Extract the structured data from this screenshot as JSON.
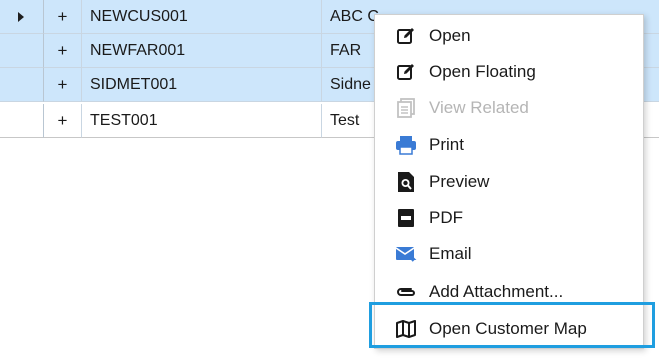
{
  "grid": {
    "rows": [
      {
        "code": "NEWCUS001",
        "name": "ABC C",
        "expand": "+",
        "selected": true,
        "current": true
      },
      {
        "code": "NEWFAR001",
        "name": "FAR",
        "expand": "+",
        "selected": true,
        "current": false
      },
      {
        "code": "SIDMET001",
        "name": "Sidne",
        "expand": "+",
        "selected": true,
        "current": false
      },
      {
        "code": "TEST001",
        "name": "Test",
        "expand": "+",
        "selected": false,
        "current": false
      }
    ]
  },
  "context_menu": {
    "items": [
      {
        "label": "Open",
        "icon": "edit-icon",
        "enabled": true
      },
      {
        "label": "Open Floating",
        "icon": "edit-icon",
        "enabled": true
      },
      {
        "label": "View Related",
        "icon": "related-documents-icon",
        "enabled": false
      },
      {
        "label": "Print",
        "icon": "printer-icon",
        "enabled": true
      },
      {
        "label": "Preview",
        "icon": "preview-icon",
        "enabled": true
      },
      {
        "label": "PDF",
        "icon": "pdf-icon",
        "enabled": true
      },
      {
        "label": "Email",
        "icon": "email-icon",
        "enabled": true
      },
      {
        "label": "Add Attachment...",
        "icon": "paperclip-icon",
        "enabled": true
      },
      {
        "label": "Open Customer Map",
        "icon": "map-icon",
        "enabled": true,
        "highlighted": true
      }
    ]
  },
  "colors": {
    "selected_row": "#cde6fb",
    "highlight_border": "#1f9ee0",
    "icon_blue": "#3a7bd5"
  }
}
